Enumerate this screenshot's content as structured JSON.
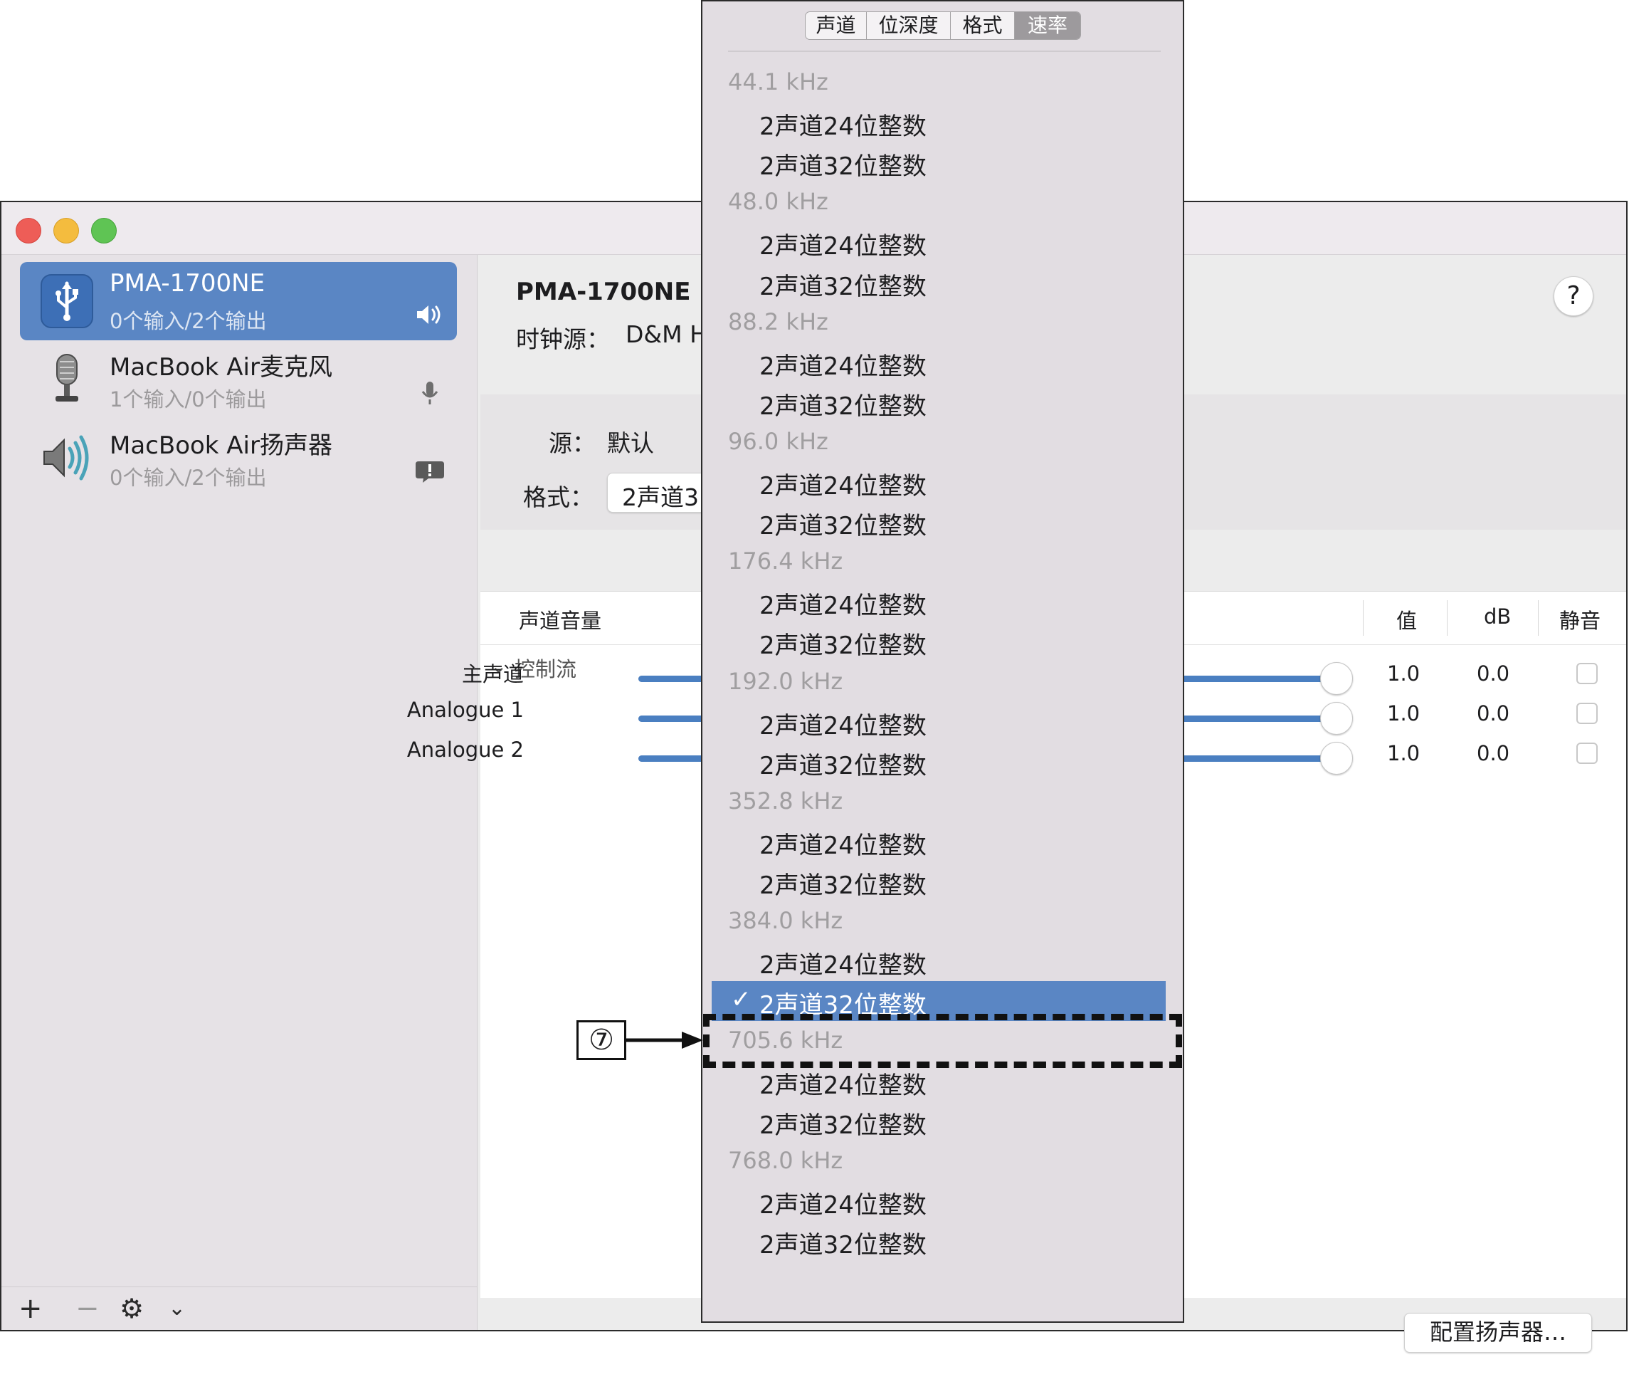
{
  "sidebar": {
    "devices": [
      {
        "name": "PMA-1700NE",
        "sub": "0个输入/2个输出",
        "icon": "usb-icon",
        "status_icon": "speaker-volume-icon",
        "selected": true
      },
      {
        "name": "MacBook Air麦克风",
        "sub": "1个输入/0个输出",
        "icon": "microphone-device-icon",
        "status_icon": "microphone-icon",
        "selected": false
      },
      {
        "name": "MacBook Air扬声器",
        "sub": "0个输入/2个输出",
        "icon": "speaker-device-icon",
        "status_icon": "alert-bubble-icon",
        "selected": false
      }
    ],
    "footer": {
      "add": "+",
      "remove": "−",
      "gear": "⚙",
      "chevron": "⌄"
    }
  },
  "content": {
    "title": "PMA-1700NE",
    "clock_label": "时钟源：",
    "clock_value": "D&M H",
    "help": "?",
    "source_label": "源：",
    "source_value": "默认",
    "format_label": "格式：",
    "format_value": "2声道3",
    "volume_header": "声道音量",
    "columns": {
      "value": "值",
      "db": "dB",
      "mute": "静音"
    },
    "flow_label": "控制流",
    "channels": [
      {
        "label": "主声道",
        "level": 1.0,
        "value": "1.0",
        "db": "0.0",
        "muted": false
      },
      {
        "label": "Analogue 1",
        "level": 1.0,
        "value": "1.0",
        "db": "0.0",
        "muted": false
      },
      {
        "label": "Analogue 2",
        "level": 1.0,
        "value": "1.0",
        "db": "0.0",
        "muted": false
      }
    ],
    "configure_button": "配置扬声器…"
  },
  "popup": {
    "tabs": [
      "声道",
      "位深度",
      "格式",
      "速率"
    ],
    "active_tab": "速率",
    "groups": [
      {
        "rate": "44.1 kHz",
        "options": [
          "2声道24位整数",
          "2声道32位整数"
        ]
      },
      {
        "rate": "48.0 kHz",
        "options": [
          "2声道24位整数",
          "2声道32位整数"
        ]
      },
      {
        "rate": "88.2 kHz",
        "options": [
          "2声道24位整数",
          "2声道32位整数"
        ]
      },
      {
        "rate": "96.0 kHz",
        "options": [
          "2声道24位整数",
          "2声道32位整数"
        ]
      },
      {
        "rate": "176.4 kHz",
        "options": [
          "2声道24位整数",
          "2声道32位整数"
        ]
      },
      {
        "rate": "192.0 kHz",
        "options": [
          "2声道24位整数",
          "2声道32位整数"
        ]
      },
      {
        "rate": "352.8 kHz",
        "options": [
          "2声道24位整数",
          "2声道32位整数"
        ]
      },
      {
        "rate": "384.0 kHz",
        "options": [
          "2声道24位整数",
          "2声道32位整数"
        ]
      },
      {
        "rate": "705.6 kHz",
        "options": [
          "2声道24位整数",
          "2声道32位整数"
        ]
      },
      {
        "rate": "768.0 kHz",
        "options": [
          "2声道24位整数",
          "2声道32位整数"
        ]
      }
    ],
    "selected": {
      "group": 7,
      "option": 1
    },
    "check": "✓"
  },
  "annotation": {
    "label": "⑦"
  },
  "colors": {
    "accent": "#5a86c4",
    "slider": "#4a7fc1",
    "group_text": "#a09ea0"
  }
}
